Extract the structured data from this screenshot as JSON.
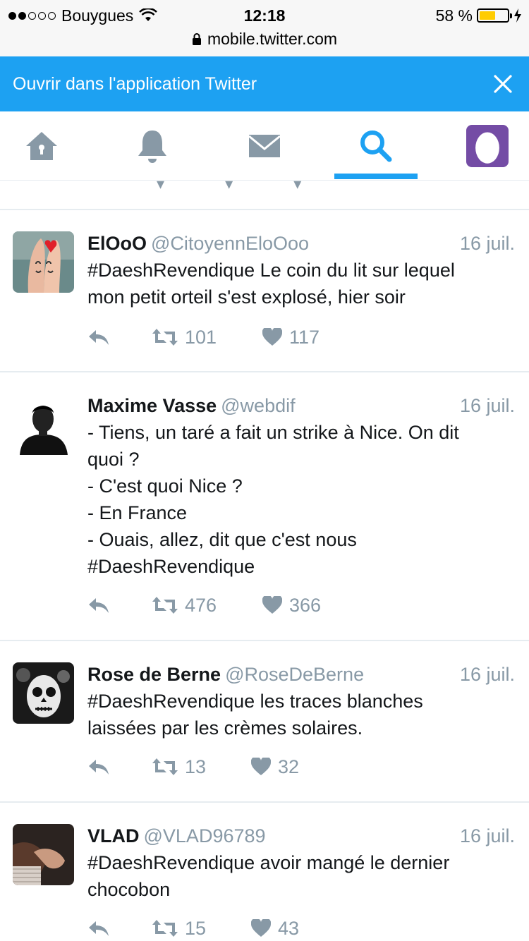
{
  "status_bar": {
    "carrier": "Bouygues",
    "time": "12:18",
    "battery": "58 %",
    "battery_level": 0.58
  },
  "url_bar": {
    "url": "mobile.twitter.com"
  },
  "banner": {
    "text": "Ouvrir dans l'application Twitter"
  },
  "nav": {
    "items": [
      "home-icon",
      "notifications-bell-icon",
      "messages-envelope-icon",
      "search-icon",
      "profile-egg-icon"
    ],
    "active": "search-icon",
    "accent": "#1da1f2"
  },
  "tweets": [
    {
      "name": "ElOoO",
      "handle": "@CitoyennEloOoo",
      "date": "16 juil.",
      "lines": [
        "#DaeshRevendique Le coin du lit sur lequel",
        "mon petit orteil s'est explosé, hier soir"
      ],
      "retweets": "101",
      "likes": "117"
    },
    {
      "name": "Maxime Vasse",
      "handle": "@webdif",
      "date": "16 juil.",
      "lines": [
        "- Tiens, un taré a fait un strike à Nice. On dit",
        "quoi ?",
        "- C'est quoi Nice ?",
        "- En France",
        "- Ouais, allez, dit que c'est nous",
        "#DaeshRevendique"
      ],
      "retweets": "476",
      "likes": "366"
    },
    {
      "name": "Rose de Berne",
      "handle": "@RoseDeBerne",
      "date": "16 juil.",
      "lines": [
        "#DaeshRevendique les traces blanches",
        "laissées par les crèmes solaires."
      ],
      "retweets": "13",
      "likes": "32"
    },
    {
      "name": "VLAD",
      "handle": "@VLAD96789",
      "date": "16 juil.",
      "lines": [
        "#DaeshRevendique avoir mangé le dernier",
        "chocobon"
      ],
      "retweets": "15",
      "likes": "43"
    }
  ]
}
